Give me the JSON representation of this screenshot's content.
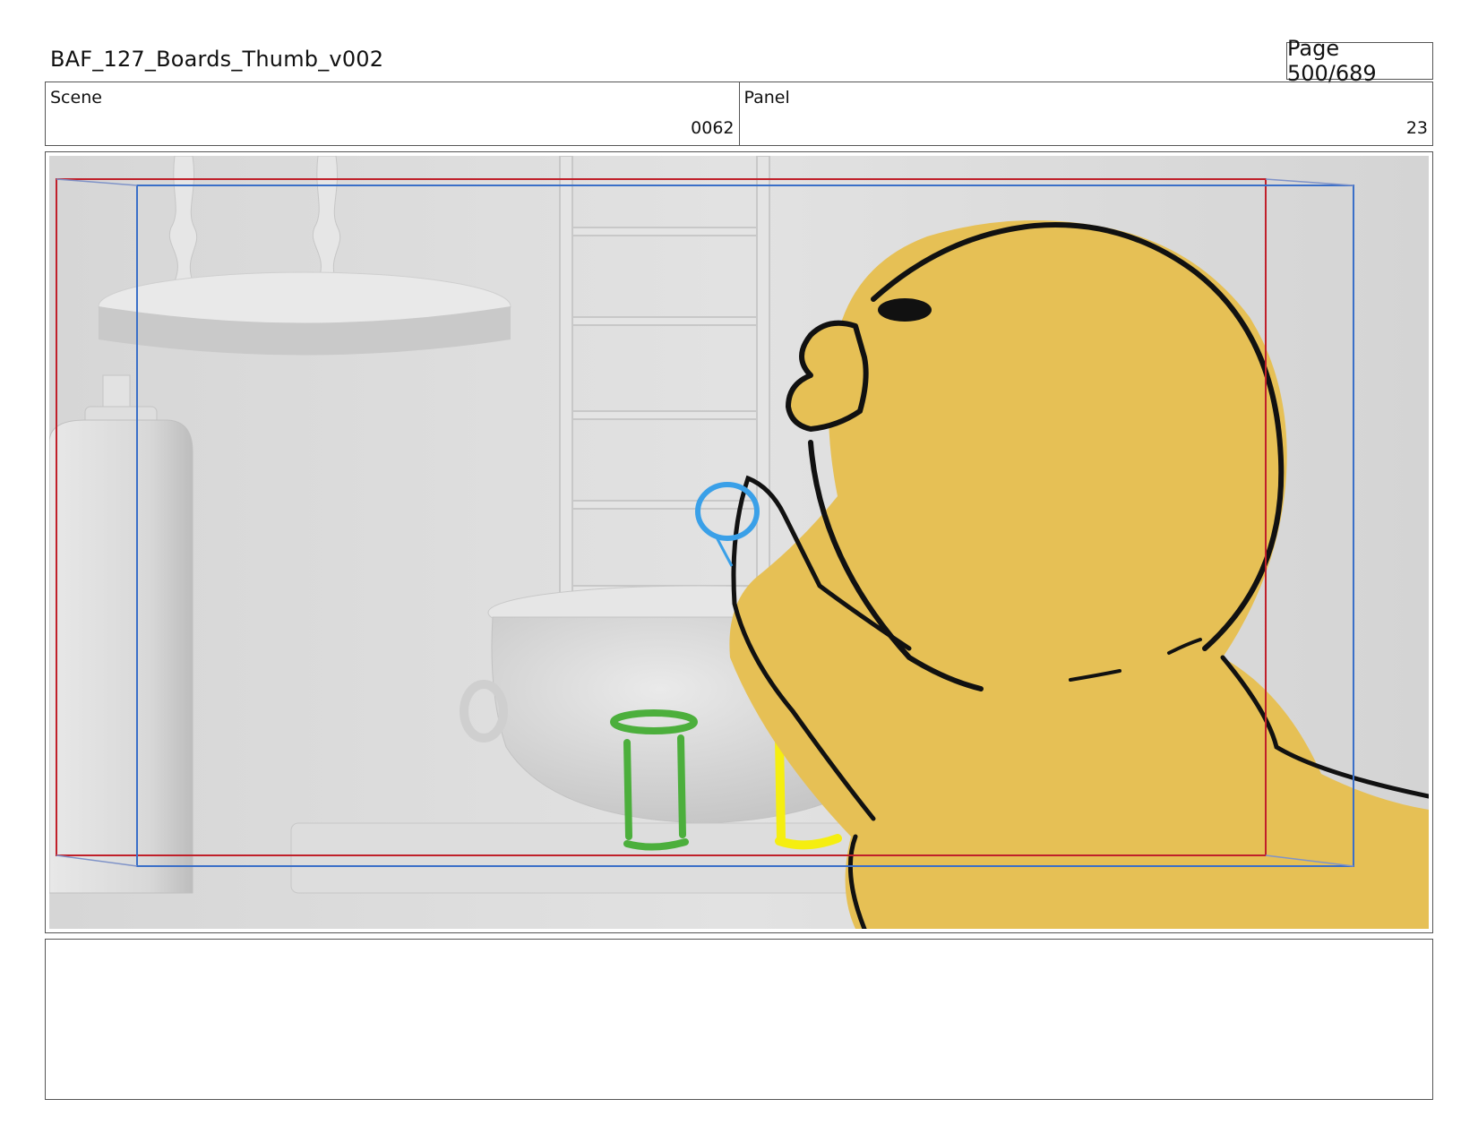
{
  "header": {
    "title": "BAF_127_Boards_Thumb_v002",
    "page_label": "Page 500/689"
  },
  "fields": {
    "scene_label": "Scene",
    "scene_value": "0062",
    "panel_label": "Panel",
    "panel_value": "23"
  },
  "notes": {
    "text": ""
  },
  "colors": {
    "safe_frame_red": "#c0202a",
    "camera_frame_blue": "#3a6fc8",
    "character_yellow": "#e6c055",
    "background_grey": "#dcdcdc",
    "bubble_blue": "#3aa0e8",
    "jar_green": "#4caf3c",
    "jar_yellow": "#f5ee10"
  }
}
